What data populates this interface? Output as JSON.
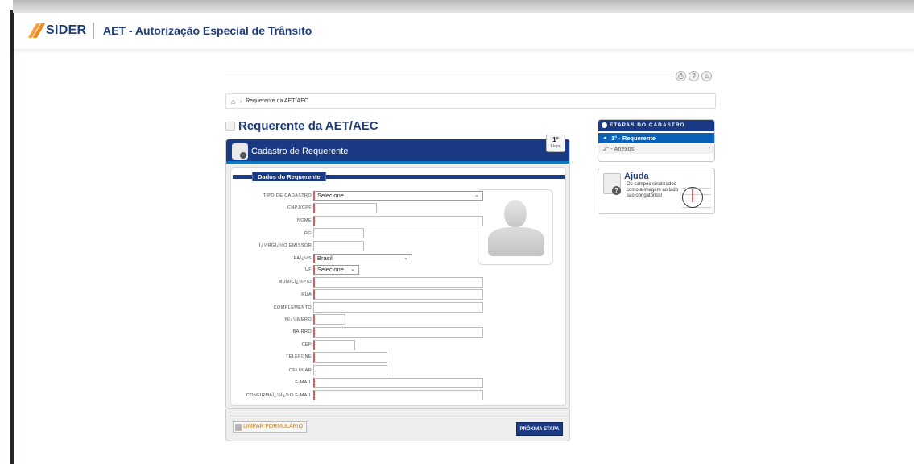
{
  "header": {
    "logo": "SIDER",
    "title": "AET - Autorização Especial de Trânsito"
  },
  "toolbar": {
    "print_icon": "print-icon",
    "help_icon": "help-icon",
    "home_icon": "home-icon",
    "help_glyph": "?",
    "home_glyph": "⌂",
    "print_glyph": "⎙"
  },
  "breadcrumb": {
    "current": "Requerente da AET/AEC"
  },
  "page": {
    "title": "Requerente da AET/AEC"
  },
  "form": {
    "card_title": "Cadastro de Requerente",
    "step_number": "1°",
    "step_label": "Etapa",
    "section_title": "Dados do Requerente",
    "fields": [
      {
        "label": "TIPO DE CADASTRO:",
        "value": "Selecione",
        "type": "select"
      },
      {
        "label": "CNPJ/CPF:",
        "value": "",
        "type": "text"
      },
      {
        "label": "NOME:",
        "value": "",
        "type": "text"
      },
      {
        "label": "RG:",
        "value": "",
        "type": "text"
      },
      {
        "label": "ï¿½RGï¿½O EMISSOR:",
        "value": "",
        "type": "text"
      },
      {
        "label": "PAï¿½S:",
        "value": "Brasil",
        "type": "select"
      },
      {
        "label": "UF:",
        "value": "Selecione",
        "type": "select"
      },
      {
        "label": "MUNICï¿½PIO:",
        "value": "",
        "type": "text"
      },
      {
        "label": "RUA:",
        "value": "",
        "type": "text"
      },
      {
        "label": "COMPLEMENTO:",
        "value": "",
        "type": "text"
      },
      {
        "label": "Nï¿½MERO:",
        "value": "",
        "type": "text"
      },
      {
        "label": "BAIRRO:",
        "value": "",
        "type": "text"
      },
      {
        "label": "CEP:",
        "value": "",
        "type": "text"
      },
      {
        "label": "TELEFONE:",
        "value": "",
        "type": "text"
      },
      {
        "label": "CELULAR:",
        "value": "",
        "type": "text"
      },
      {
        "label": "E-MAIL:",
        "value": "",
        "type": "text"
      },
      {
        "label": "CONFIRMAï¿½ï¿½O E-MAIL:",
        "value": "",
        "type": "text"
      }
    ],
    "clear_button": "LIMPAR FORMULÁRIO",
    "next_button": "PRÓXIMA ETAPA"
  },
  "steps": {
    "title": "ETAPAS DO CADASTRO",
    "items": [
      {
        "label": "1° - Requerente",
        "active": true
      },
      {
        "label": "2° - Anexos",
        "active": false
      }
    ]
  },
  "help": {
    "title": "Ajuda",
    "text": "Os campos sinalizados como a imagem ao lado são obrigatórios!"
  },
  "colors": {
    "brand_blue": "#1b3a84",
    "accent_blue": "#0a62b8",
    "logo_orange": "#f08a1c",
    "required_red": "#e05a5a"
  }
}
